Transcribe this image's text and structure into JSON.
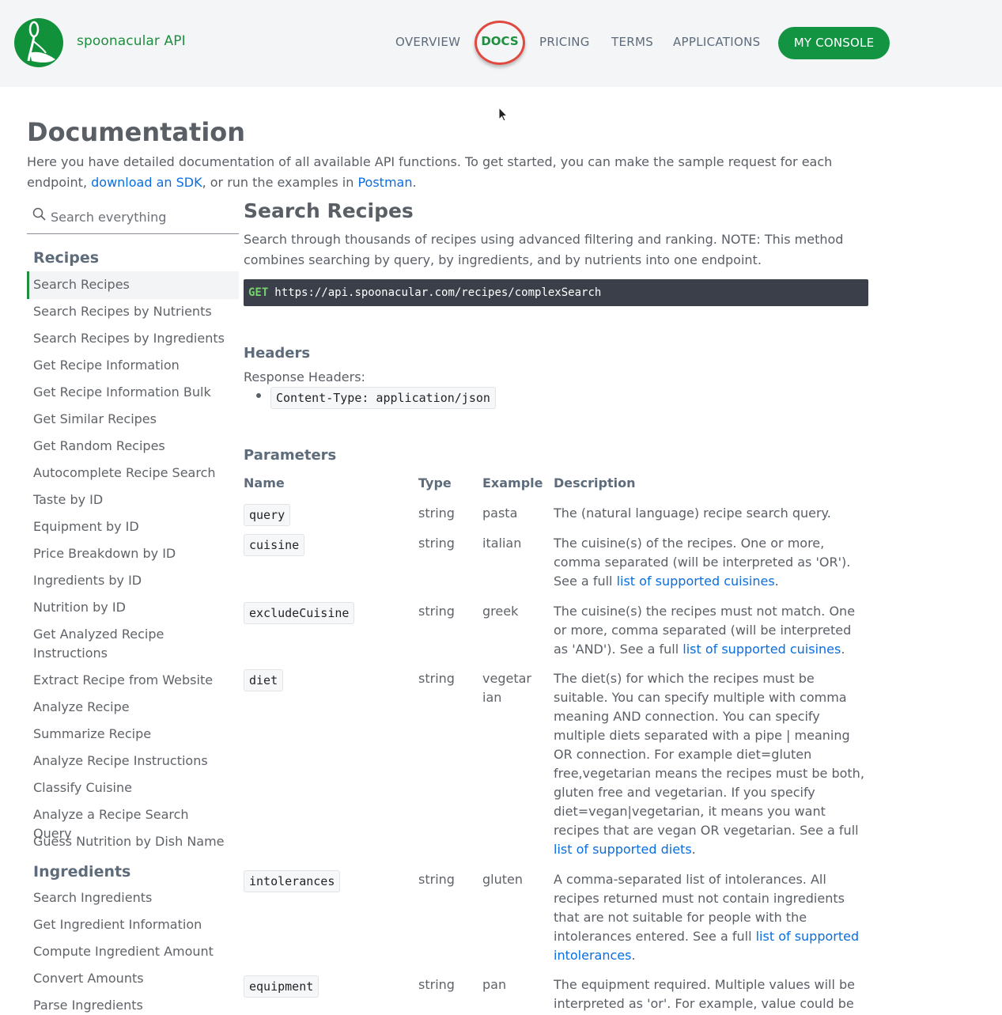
{
  "header": {
    "brand": "spoonacular API",
    "nav": [
      "OVERVIEW",
      "DOCS",
      "PRICING",
      "TERMS",
      "APPLICATIONS"
    ],
    "console_label": "MY CONSOLE"
  },
  "page": {
    "title": "Documentation",
    "intro_text_1": "Here you have detailed documentation of all available API functions. To get started, you can make the sample request for each endpoint,",
    "intro_link_sdk": "download an SDK",
    "intro_text_2": ", or run the examples in",
    "intro_link_postman": "Postman",
    "intro_text_3": "."
  },
  "sidebar": {
    "search_placeholder": "Search everything",
    "sections": [
      {
        "title": "Recipes",
        "items": [
          "Search Recipes",
          "Search Recipes by Nutrients",
          "Search Recipes by Ingredients",
          "Get Recipe Information",
          "Get Recipe Information Bulk",
          "Get Similar Recipes",
          "Get Random Recipes",
          "Autocomplete Recipe Search",
          "Taste by ID",
          "Equipment by ID",
          "Price Breakdown by ID",
          "Ingredients by ID",
          "Nutrition by ID",
          "Get Analyzed Recipe Instructions",
          "Extract Recipe from Website",
          "Analyze Recipe",
          "Summarize Recipe",
          "Analyze Recipe Instructions",
          "Classify Cuisine",
          "Analyze a Recipe Search Query",
          "Guess Nutrition by Dish Name"
        ]
      },
      {
        "title": "Ingredients",
        "items": [
          "Search Ingredients",
          "Get Ingredient Information",
          "Compute Ingredient Amount",
          "Convert Amounts",
          "Parse Ingredients"
        ]
      }
    ]
  },
  "main": {
    "title": "Search Recipes",
    "description": "Search through thousands of recipes using advanced filtering and ranking. NOTE: This method combines searching by query, by ingredients, and by nutrients into one endpoint.",
    "method": "GET",
    "url": "https://api.spoonacular.com/recipes/complexSearch",
    "headers_title": "Headers",
    "response_headers_label": "Response Headers:",
    "response_header": "Content-Type: application/json",
    "parameters_title": "Parameters",
    "columns": [
      "Name",
      "Type",
      "Example",
      "Description"
    ],
    "params": [
      {
        "name": "query",
        "type": "string",
        "example": "pasta",
        "desc": "The (natural language) recipe search query.",
        "link": "",
        "tail": ""
      },
      {
        "name": "cuisine",
        "type": "string",
        "example": "italian",
        "desc": "The cuisine(s) of the recipes. One or more, comma separated (will be interpreted as 'OR'). See a full",
        "link": "list of supported cuisines",
        "tail": "."
      },
      {
        "name": "excludeCuisine",
        "type": "string",
        "example": "greek",
        "desc": "The cuisine(s) the recipes must not match. One or more, comma separated (will be interpreted as 'AND'). See a full",
        "link": "list of supported cuisines",
        "tail": "."
      },
      {
        "name": "diet",
        "type": "string",
        "example": "vegetarian",
        "desc": "The diet(s) for which the recipes must be suitable. You can specify multiple with comma meaning AND connection. You can specify multiple diets separated with a pipe | meaning OR connection. For example diet=gluten free,vegetarian means the recipes must be both, gluten free and vegetarian. If you specify diet=vegan|vegetarian, it means you want recipes that are vegan OR vegetarian. See a full",
        "link": "list of supported diets",
        "tail": "."
      },
      {
        "name": "intolerances",
        "type": "string",
        "example": "gluten",
        "desc": "A comma-separated list of intolerances. All recipes returned must not contain ingredients that are not suitable for people with the intolerances entered. See a full",
        "link": "list of supported intolerances",
        "tail": "."
      },
      {
        "name": "equipment",
        "type": "string",
        "example": "pan",
        "desc": "The equipment required. Multiple values will be interpreted as 'or'. For example, value could be",
        "link": "",
        "tail": ""
      }
    ]
  }
}
